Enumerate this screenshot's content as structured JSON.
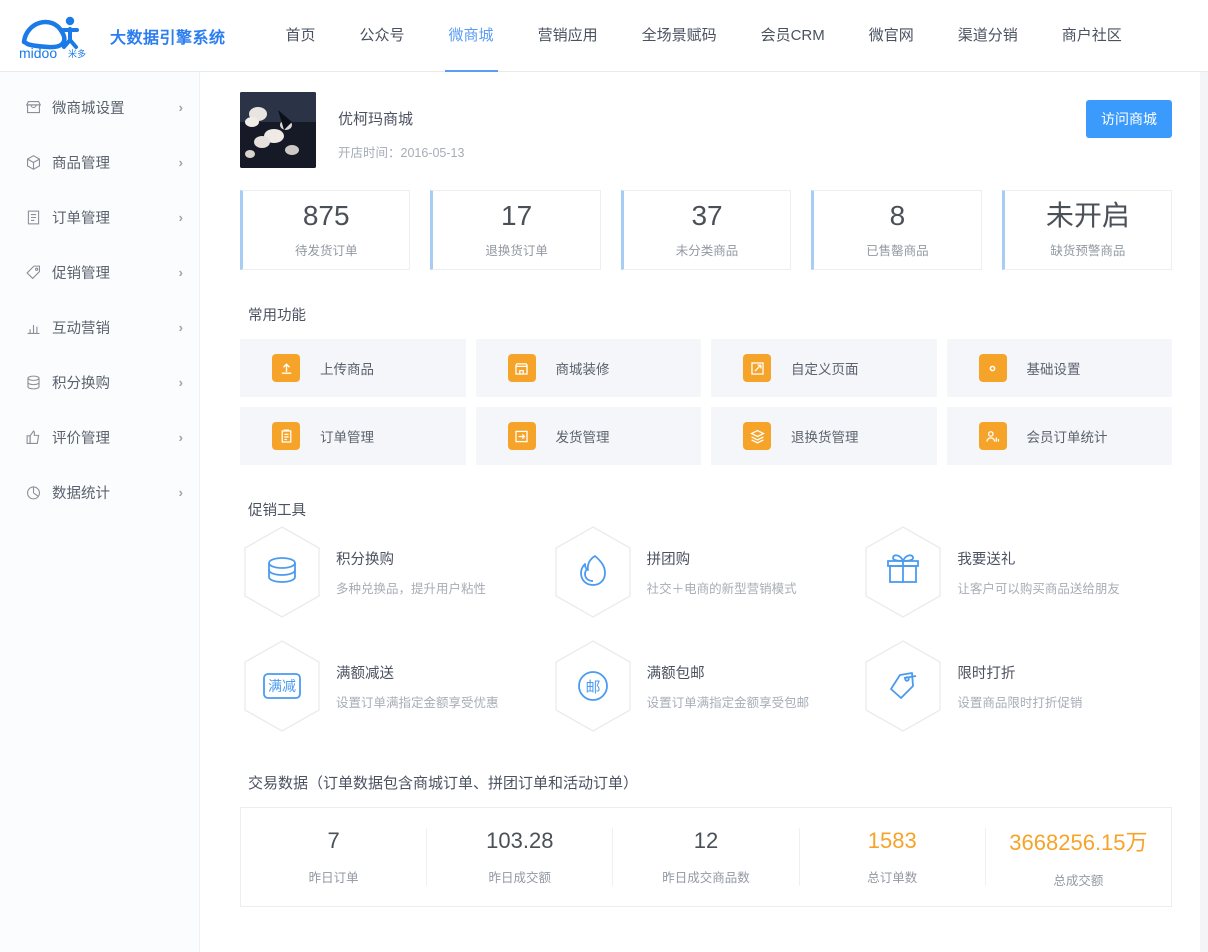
{
  "brand": {
    "logo_text": "midoo",
    "logo_sub": "米多",
    "title": "大数据引擎系统"
  },
  "nav": {
    "items": [
      {
        "label": "首页",
        "active": false
      },
      {
        "label": "公众号",
        "active": false
      },
      {
        "label": "微商城",
        "active": true
      },
      {
        "label": "营销应用",
        "active": false
      },
      {
        "label": "全场景赋码",
        "active": false
      },
      {
        "label": "会员CRM",
        "active": false
      },
      {
        "label": "微官网",
        "active": false
      },
      {
        "label": "渠道分销",
        "active": false
      },
      {
        "label": "商户社区",
        "active": false
      }
    ]
  },
  "sidebar": {
    "items": [
      {
        "label": "微商城设置",
        "icon": "shop-icon",
        "arrow": "›"
      },
      {
        "label": "商品管理",
        "icon": "box-icon",
        "arrow": "›"
      },
      {
        "label": "订单管理",
        "icon": "list-icon",
        "arrow": "›"
      },
      {
        "label": "促销管理",
        "icon": "tag-icon",
        "arrow": "›"
      },
      {
        "label": "互动营销",
        "icon": "bar-chart-icon",
        "arrow": "›"
      },
      {
        "label": "积分换购",
        "icon": "database-icon",
        "arrow": "›"
      },
      {
        "label": "评价管理",
        "icon": "thumbs-up-icon",
        "arrow": "›"
      },
      {
        "label": "数据统计",
        "icon": "pie-chart-icon",
        "arrow": "›"
      }
    ]
  },
  "shop": {
    "name": "优柯玛商城",
    "open_label": "开店时间：2016-05-13",
    "visit_button": "访问商城"
  },
  "stats": [
    {
      "value": "875",
      "label": "待发货订单"
    },
    {
      "value": "17",
      "label": "退换货订单"
    },
    {
      "value": "37",
      "label": "未分类商品"
    },
    {
      "value": "8",
      "label": "已售罄商品"
    },
    {
      "value": "未开启",
      "label": "缺货预警商品"
    }
  ],
  "common_functions": {
    "title": "常用功能",
    "items": [
      {
        "label": "上传商品",
        "icon": "upload-icon"
      },
      {
        "label": "商城装修",
        "icon": "store-icon"
      },
      {
        "label": "自定义页面",
        "icon": "edit-icon"
      },
      {
        "label": "基础设置",
        "icon": "gear-icon"
      },
      {
        "label": "订单管理",
        "icon": "clipboard-icon"
      },
      {
        "label": "发货管理",
        "icon": "shipping-icon"
      },
      {
        "label": "退换货管理",
        "icon": "return-box-icon"
      },
      {
        "label": "会员订单统计",
        "icon": "member-stats-icon"
      }
    ]
  },
  "promo_tools": {
    "title": "促销工具",
    "items": [
      {
        "name": "积分换购",
        "desc": "多种兑换品，提升用户粘性",
        "icon": "coins-icon"
      },
      {
        "name": "拼团购",
        "desc": "社交＋电商的新型营销模式",
        "icon": "flame-icon"
      },
      {
        "name": "我要送礼",
        "desc": "让客户可以购买商品送给朋友",
        "icon": "gift-icon"
      },
      {
        "name": "满额减送",
        "desc": "设置订单满指定金额享受优惠",
        "icon": "manjian-icon"
      },
      {
        "name": "满额包邮",
        "desc": "设置订单满指定金额享受包邮",
        "icon": "post-icon"
      },
      {
        "name": "限时打折",
        "desc": "设置商品限时打折促销",
        "icon": "discount-tag-icon"
      }
    ]
  },
  "trade": {
    "title": "交易数据",
    "subtitle": "（订单数据包含商城订单、拼团订单和活动订单）",
    "cells": [
      {
        "value": "7",
        "label": "昨日订单",
        "accent": false
      },
      {
        "value": "103.28",
        "label": "昨日成交额",
        "accent": false
      },
      {
        "value": "12",
        "label": "昨日成交商品数",
        "accent": false
      },
      {
        "value": "1583",
        "label": "总订单数",
        "accent": true
      },
      {
        "value": "3668256.15万",
        "label": "总成交额",
        "accent": true
      }
    ]
  },
  "colors": {
    "brand_blue": "#2c7ef0",
    "nav_active": "#5b9cf5",
    "button_blue": "#3a9bfc",
    "accent_orange": "#f6a429",
    "card_border_blue": "#a8cdf5",
    "page_bg": "#f4f5f7"
  }
}
